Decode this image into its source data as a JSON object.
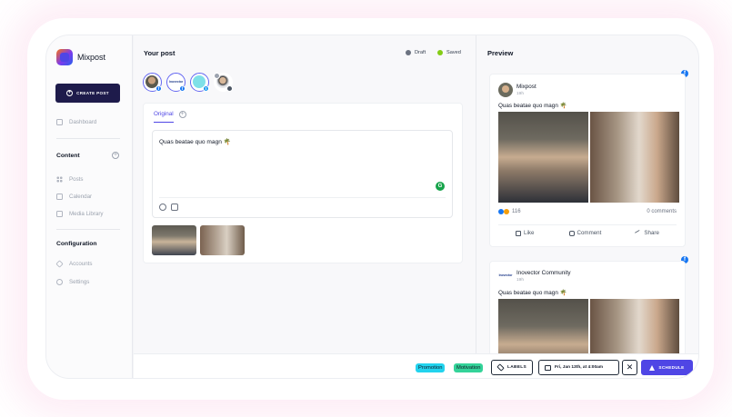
{
  "app": {
    "name": "Mixpost"
  },
  "sidebar": {
    "create_label": "CREATE POST",
    "dashboard": "Dashboard",
    "content_title": "Content",
    "content_items": [
      "Posts",
      "Calendar",
      "Media Library"
    ],
    "configuration_title": "Configuration",
    "configuration_items": [
      "Accounts",
      "Settings"
    ]
  },
  "editor": {
    "title": "Your post",
    "status_draft": "Draft",
    "status_saved": "Saved",
    "account_logo_text": "Inovector",
    "tab_original": "Original",
    "text": "Quas beatae quo magn 🌴",
    "grammar_badge": "G"
  },
  "preview": {
    "title": "Preview",
    "posts": [
      {
        "name": "Mixpost",
        "time": "19h",
        "text": "Quas beatae quo magn 🌴",
        "reactions": "116",
        "comments": "0 comments",
        "actions": [
          "Like",
          "Comment",
          "Share"
        ]
      },
      {
        "name": "Inovector Community",
        "avatar_text": "Inovector",
        "time": "19h",
        "text": "Quas beatae quo magn 🌴"
      }
    ],
    "network_badge": "f"
  },
  "footer": {
    "tags": [
      "Promotion",
      "Motivation"
    ],
    "labels_btn": "LABELS",
    "date": "Fri, Jan 13th, at 4:00am",
    "close": "✕",
    "schedule_btn": "SCHEDULE"
  },
  "colors": {
    "accent": "#4f46e5",
    "create_button": "#1e1b4b",
    "draft_dot": "#6b7280",
    "saved_dot": "#84cc16",
    "tag_promotion": "#22d3ee",
    "tag_motivation": "#34d399",
    "facebook": "#1877f2"
  }
}
